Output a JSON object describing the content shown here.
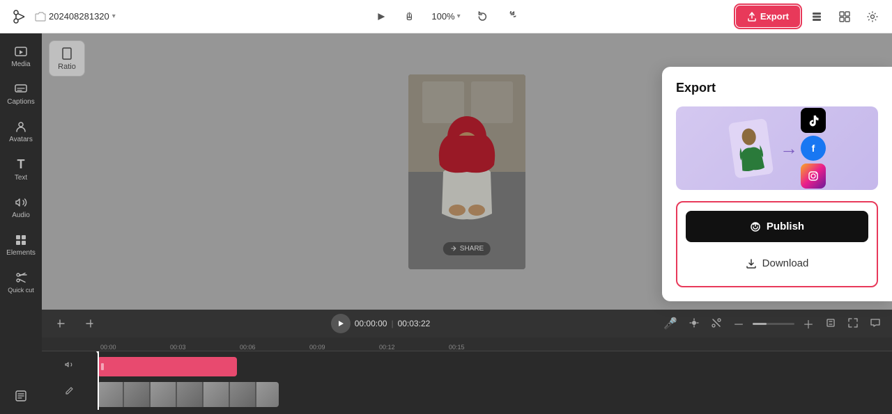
{
  "topbar": {
    "logo_icon": "✂",
    "project_name": "202408281320",
    "chevron_icon": "▾",
    "play_icon": "▷",
    "hand_icon": "✋",
    "zoom_label": "100%",
    "zoom_chevron": "▾",
    "undo_icon": "↩",
    "redo_icon": "↪",
    "export_label": "Export",
    "export_icon": "⬆",
    "layers_icon": "⊟",
    "layout_icon": "⊞",
    "settings_icon": "⚙"
  },
  "sidebar": {
    "items": [
      {
        "label": "Media",
        "icon": "🖼"
      },
      {
        "label": "Captions",
        "icon": "💬"
      },
      {
        "label": "Avatars",
        "icon": "👤"
      },
      {
        "label": "Text",
        "icon": "T"
      },
      {
        "label": "Audio",
        "icon": "♪"
      },
      {
        "label": "Elements",
        "icon": "✦"
      },
      {
        "label": "Quick cut",
        "icon": "✂"
      }
    ],
    "bottom_items": [
      {
        "label": "",
        "icon": "⬜"
      }
    ]
  },
  "canvas": {
    "ratio_label": "Ratio",
    "share_label": "SHARE"
  },
  "timeline": {
    "play_icon": "▶",
    "current_time": "00:00:00",
    "separator": "|",
    "total_time": "00:03:22",
    "mic_icon": "🎤",
    "markers_icon": "◈",
    "cut_icon": "⊣",
    "zoom_out_icon": "－",
    "zoom_in_icon": "＋",
    "fit_icon": "⊡",
    "expand_icon": "⛶",
    "comment_icon": "💬",
    "ruler_marks": [
      "00:00",
      "00:03",
      "00:06",
      "00:09",
      "00:12",
      "00:15"
    ],
    "track_side_volume": "🔊",
    "track_side_edit": "✏"
  },
  "export_popup": {
    "title": "Export",
    "publish_label": "Publish",
    "publish_icon": "⟳",
    "download_label": "Download",
    "download_icon": "⬇",
    "social_tiktok": "♪",
    "social_fb": "f",
    "social_ig": "◎",
    "figure_icon": "🕴",
    "arrow_icon": "➜"
  }
}
